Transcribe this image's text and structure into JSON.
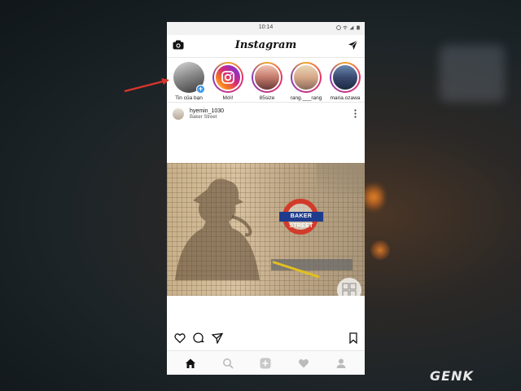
{
  "status_bar": {
    "time": "10:14"
  },
  "header": {
    "brand": "Instagram",
    "icons": [
      "camera-icon",
      "direct-message-icon"
    ]
  },
  "stories": [
    {
      "label": "Tin của bạn",
      "own": true
    },
    {
      "label": "Mới!"
    },
    {
      "label": "85size"
    },
    {
      "label": "rang.___rang"
    },
    {
      "label": "maria.ozawa"
    }
  ],
  "post": {
    "username": "hyemin_1030",
    "location": "Baker Street",
    "image_sign_text": "BAKER STREET"
  },
  "action_icons": [
    "heart-icon",
    "comment-icon",
    "share-icon",
    "bookmark-icon"
  ],
  "bottom_nav": [
    "home-icon",
    "search-icon",
    "add-post-icon",
    "activity-heart-icon",
    "profile-icon"
  ],
  "watermark": "GENK",
  "colors": {
    "accent_blue": "#3897f0",
    "annotation_red": "#d9352b",
    "sign_red": "#d23a2a",
    "sign_blue": "#1f3c8c"
  }
}
